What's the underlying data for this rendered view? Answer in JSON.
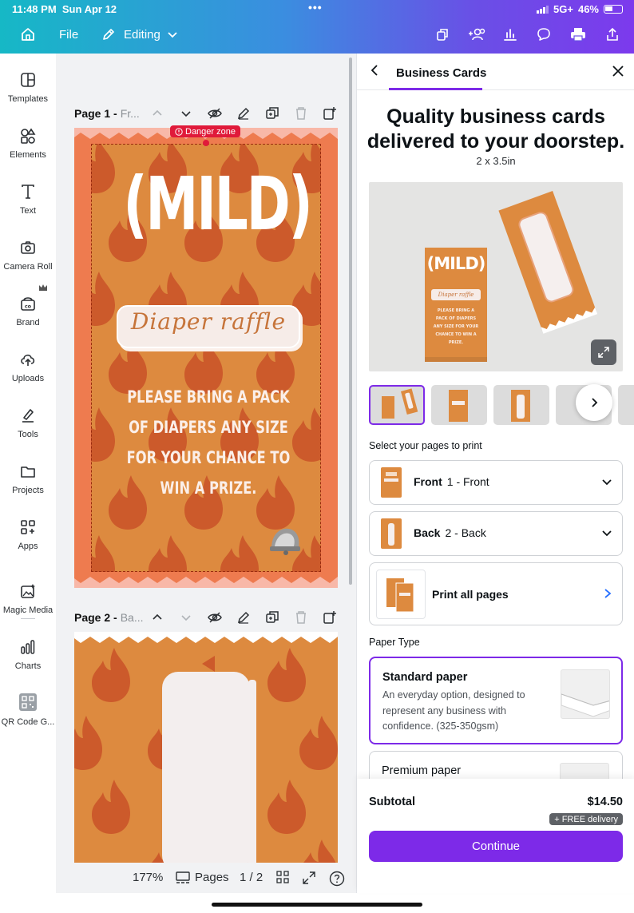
{
  "status_bar": {
    "time": "11:48 PM",
    "date": "Sun Apr 12",
    "network": "5G+",
    "battery": "46%"
  },
  "toolbar": {
    "file_label": "File",
    "editing_label": "Editing",
    "icons": [
      "home-icon",
      "pencil-icon",
      "chevron-down-icon",
      "resize-icon",
      "add-people-icon",
      "analytics-icon",
      "comment-icon",
      "print-icon",
      "share-icon"
    ]
  },
  "sidebar": {
    "items": [
      {
        "label": "Templates",
        "icon": "templates-icon"
      },
      {
        "label": "Elements",
        "icon": "elements-icon"
      },
      {
        "label": "Text",
        "icon": "text-icon"
      },
      {
        "label": "Camera Roll",
        "icon": "camera-icon"
      },
      {
        "label": "Brand",
        "icon": "brand-icon"
      },
      {
        "label": "Uploads",
        "icon": "upload-icon"
      },
      {
        "label": "Tools",
        "icon": "tools-icon"
      },
      {
        "label": "Projects",
        "icon": "folder-icon"
      },
      {
        "label": "Apps",
        "icon": "apps-icon"
      },
      {
        "label": "Magic Media",
        "icon": "magic-media-icon"
      },
      {
        "label": "Charts",
        "icon": "charts-icon"
      },
      {
        "label": "QR Code G...",
        "icon": "qr-code-icon"
      }
    ]
  },
  "canvas": {
    "page1": {
      "name": "Page 1 -",
      "subtitle": "Fr..."
    },
    "page2": {
      "name": "Page 2 -",
      "subtitle": "Ba..."
    },
    "danger_zone": "Danger zone",
    "design": {
      "headline": "(MILD)",
      "raffle": "Diaper raffle",
      "body": [
        "PLEASE BRING A PACK",
        "OF DIAPERS ANY SIZE",
        "FOR YOUR CHANCE TO",
        "WIN A PRIZE."
      ]
    }
  },
  "bottom_bar": {
    "zoom": "177%",
    "pages_label": "Pages",
    "page_count": "1 / 2"
  },
  "panel": {
    "tab_title": "Business Cards",
    "headline": "Quality business cards delivered to your doorstep.",
    "dimensions": "2 x 3.5in",
    "select_label": "Select your pages to print",
    "options": [
      {
        "title": "Front",
        "sub": "1 - Front"
      },
      {
        "title": "Back",
        "sub": "2 - Back"
      },
      {
        "title": "Print all pages",
        "sub": ""
      }
    ],
    "paper_type_label": "Paper Type",
    "papers": [
      {
        "title": "Standard paper",
        "desc": "An everyday option, designed to represent any business with confidence. (325-350gsm)",
        "selected": true
      },
      {
        "title": "Premium paper",
        "desc": "",
        "selected": false
      }
    ],
    "subtotal_label": "Subtotal",
    "subtotal_value": "$14.50",
    "delivery_badge": "+ FREE delivery",
    "continue_label": "Continue",
    "mock_headline": "(MILD)",
    "mock_raffle": "Diaper raffle",
    "mock_body": "PLEASE BRING A PACK OF DIAPERS ANY SIZE FOR YOUR CHANCE TO WIN A PRIZE."
  },
  "colors": {
    "accent": "#7d2ae8",
    "card_orange": "#dd8a3f",
    "card_border": "#ee7b4f",
    "flame": "#cc5a2b",
    "danger": "#e01a3a"
  }
}
